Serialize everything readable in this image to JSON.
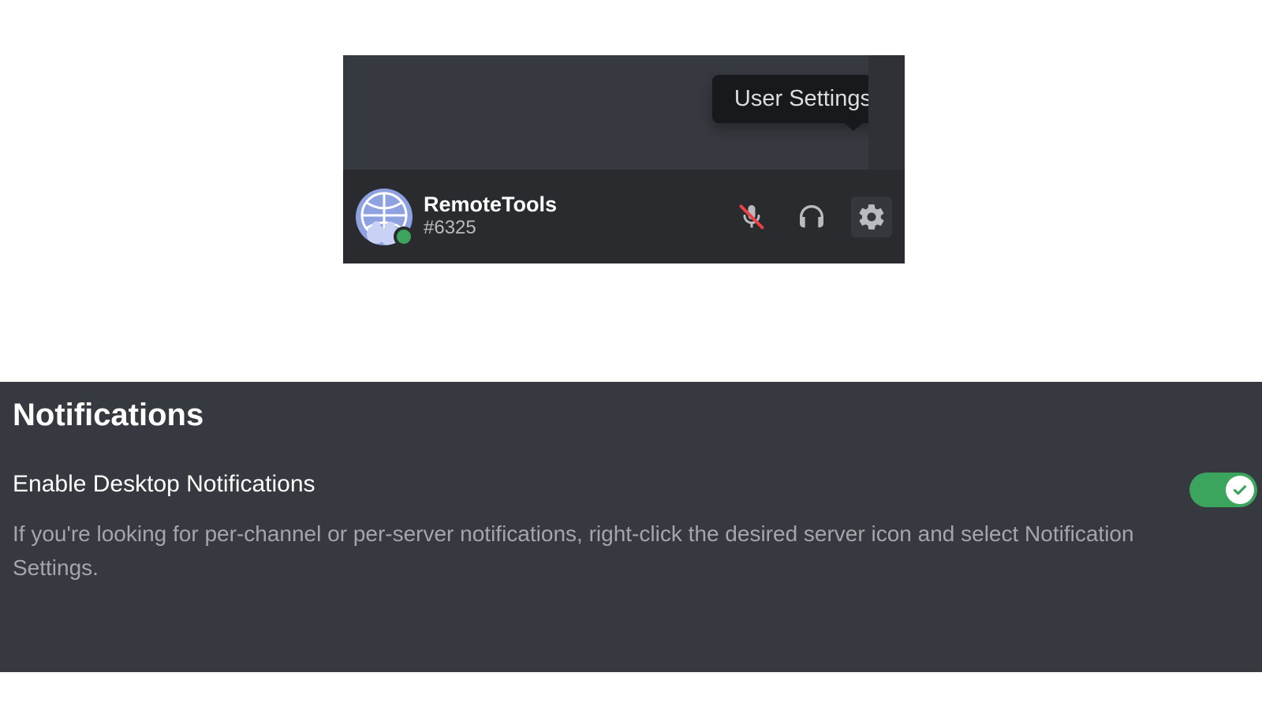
{
  "tooltip": {
    "label": "User Settings"
  },
  "user": {
    "name": "RemoteTools",
    "discriminator": "#6325"
  },
  "settings": {
    "title": "Notifications",
    "desktop": {
      "label": "Enable Desktop Notifications",
      "description": "If you're looking for per-channel or per-server notifications, right-click the desired server icon and select Notification Settings.",
      "enabled": true
    }
  },
  "colors": {
    "panel_bg": "#36393f",
    "darker_bg": "#292b2f",
    "tooltip_bg": "#18191c",
    "text_primary": "#ffffff",
    "text_muted": "#b9bbbe",
    "text_desc": "#a3a6aa",
    "green": "#3ba55d",
    "avatar_bg": "#8ea1e1"
  }
}
